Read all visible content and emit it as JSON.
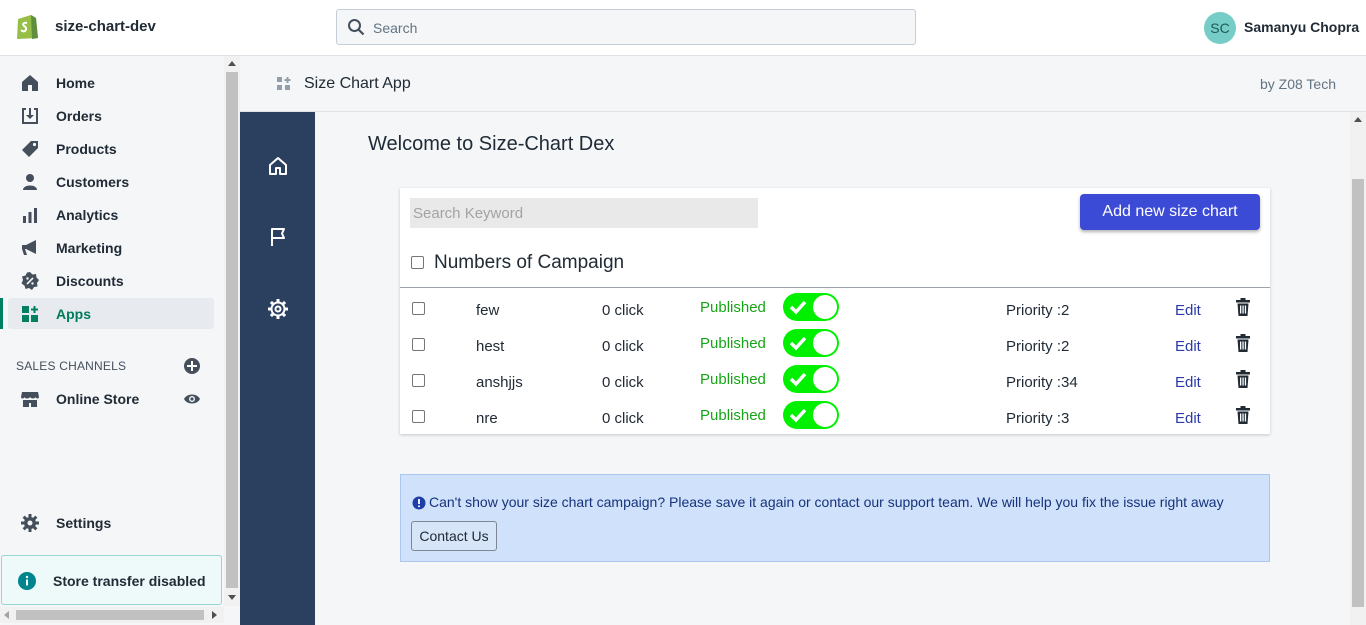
{
  "topbar": {
    "store_name": "size-chart-dev",
    "search_placeholder": "Search",
    "user_initials": "SC",
    "user_name": "Samanyu Chopra"
  },
  "sidebar": {
    "items": [
      {
        "label": "Home",
        "icon": "home-icon"
      },
      {
        "label": "Orders",
        "icon": "orders-icon"
      },
      {
        "label": "Products",
        "icon": "tag-icon"
      },
      {
        "label": "Customers",
        "icon": "person-icon"
      },
      {
        "label": "Analytics",
        "icon": "bar-chart-icon"
      },
      {
        "label": "Marketing",
        "icon": "megaphone-icon"
      },
      {
        "label": "Discounts",
        "icon": "discount-icon"
      },
      {
        "label": "Apps",
        "icon": "apps-icon",
        "active": true
      }
    ],
    "sales_channels_heading": "SALES CHANNELS",
    "online_store_label": "Online Store",
    "settings_label": "Settings",
    "store_transfer_notice": "Store transfer disabled"
  },
  "app_header": {
    "title": "Size Chart App",
    "by": "by Z08 Tech"
  },
  "app": {
    "welcome": "Welcome to Size-Chart Dex",
    "search_placeholder": "Search Keyword",
    "add_button": "Add new size chart",
    "numbers_heading": "Numbers of Campaign",
    "rows": [
      {
        "name": "few",
        "clicks": "0 click",
        "status": "Published",
        "priority": "Priority :2",
        "edit": "Edit"
      },
      {
        "name": "hest",
        "clicks": "0 click",
        "status": "Published",
        "priority": "Priority :2",
        "edit": "Edit"
      },
      {
        "name": "anshjjs",
        "clicks": "0 click",
        "status": "Published",
        "priority": "Priority :34",
        "edit": "Edit"
      },
      {
        "name": "nre",
        "clicks": "0 click",
        "status": "Published",
        "priority": "Priority :3",
        "edit": "Edit"
      }
    ],
    "notice_text": "Can't show your size chart campaign? Please save it again or contact our support team. We will help you fix the issue right away",
    "contact_button": "Contact Us"
  },
  "colors": {
    "accent_green": "#008060",
    "app_nav_bg": "#2b3f5f",
    "button_blue": "#3b4bd6",
    "toggle_green": "#00f000"
  }
}
